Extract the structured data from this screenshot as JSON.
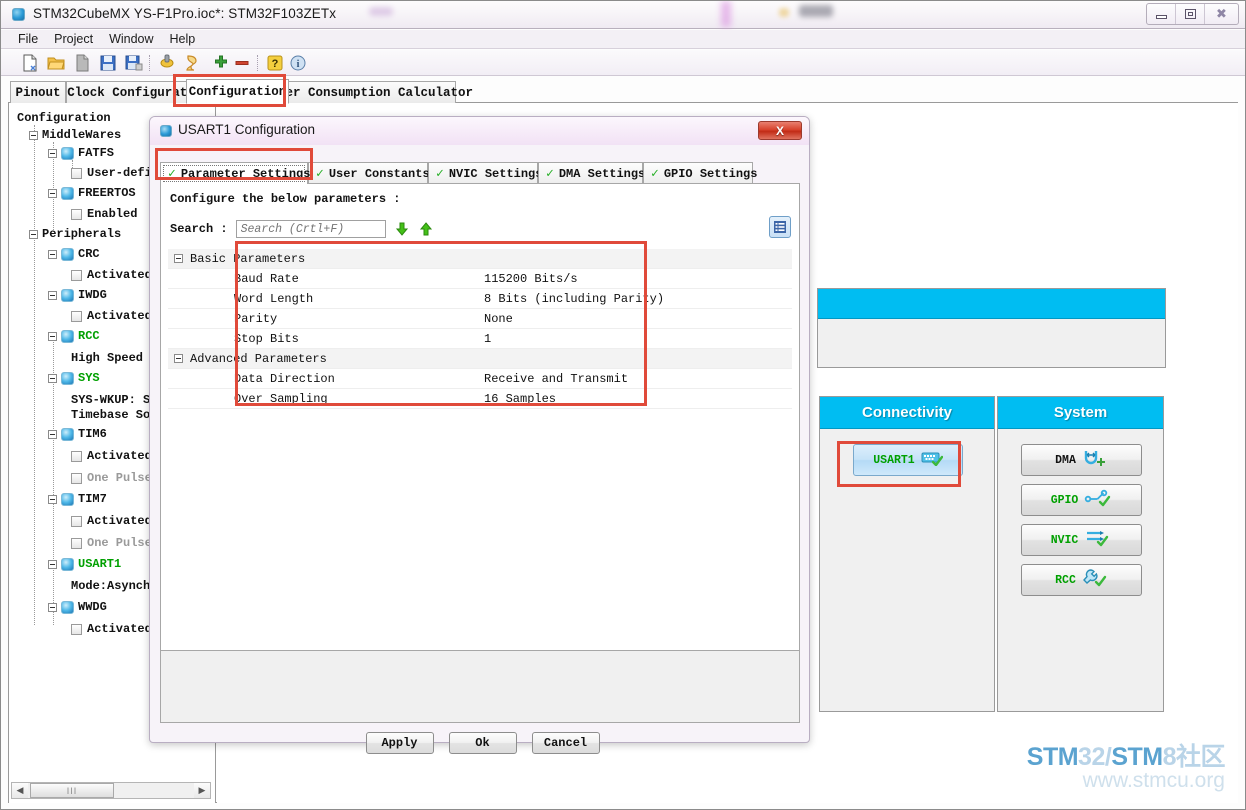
{
  "window": {
    "title": "STM32CubeMX YS-F1Pro.ioc*: STM32F103ZETx",
    "app_icon": "stm32cubemx-icon",
    "minimize": "minimize-icon",
    "maximize": "maximize-icon",
    "close": "close-icon"
  },
  "menubar": {
    "items": [
      "File",
      "Project",
      "Window",
      "Help"
    ]
  },
  "toolbar": {
    "icons": [
      "new-project-icon",
      "open-project-icon",
      "copy-icon",
      "save-icon",
      "save-as-icon",
      "generate-report-icon",
      "generate-code-icon",
      "zoom-in-icon",
      "zoom-out-icon",
      "help-icon",
      "about-icon"
    ]
  },
  "main_tabs": {
    "items": [
      {
        "label": "Pinout",
        "active": false
      },
      {
        "label": "Clock Configuration",
        "active": false
      },
      {
        "label": "Configuration",
        "active": true
      },
      {
        "label": "Power Consumption Calculator",
        "active": false
      }
    ]
  },
  "tree": {
    "root_label": "Configuration",
    "nodes": [
      {
        "label": "MiddleWares",
        "type": "group",
        "indent": 0
      },
      {
        "label": "FATFS",
        "type": "peripheral",
        "indent": 1,
        "state": "off"
      },
      {
        "label": "User-defi",
        "type": "checkbox",
        "indent": 2,
        "enabled": true
      },
      {
        "label": "FREERTOS",
        "type": "peripheral",
        "indent": 1,
        "state": "off"
      },
      {
        "label": "Enabled",
        "type": "checkbox",
        "indent": 2,
        "enabled": true
      },
      {
        "label": "Peripherals",
        "type": "group",
        "indent": 0
      },
      {
        "label": "CRC",
        "type": "peripheral",
        "indent": 1,
        "state": "off"
      },
      {
        "label": "Activated",
        "type": "checkbox",
        "indent": 2,
        "enabled": true
      },
      {
        "label": "IWDG",
        "type": "peripheral",
        "indent": 1,
        "state": "off"
      },
      {
        "label": "Activated",
        "type": "checkbox",
        "indent": 2,
        "enabled": true
      },
      {
        "label": "RCC",
        "type": "peripheral",
        "indent": 1,
        "state": "on"
      },
      {
        "label": "High Speed",
        "type": "text",
        "indent": 2
      },
      {
        "label": "SYS",
        "type": "peripheral",
        "indent": 1,
        "state": "on"
      },
      {
        "label": "SYS-WKUP: S",
        "type": "text",
        "indent": 2
      },
      {
        "label": "Timebase So",
        "type": "text",
        "indent": 2
      },
      {
        "label": "TIM6",
        "type": "peripheral",
        "indent": 1,
        "state": "off"
      },
      {
        "label": "Activated",
        "type": "checkbox",
        "indent": 2,
        "enabled": true
      },
      {
        "label": "One Pulse",
        "type": "checkbox",
        "indent": 2,
        "enabled": false
      },
      {
        "label": "TIM7",
        "type": "peripheral",
        "indent": 1,
        "state": "off"
      },
      {
        "label": "Activated",
        "type": "checkbox",
        "indent": 2,
        "enabled": true
      },
      {
        "label": "One Pulse",
        "type": "checkbox",
        "indent": 2,
        "enabled": false
      },
      {
        "label": "USART1",
        "type": "peripheral",
        "indent": 1,
        "state": "on"
      },
      {
        "label": "Mode:Asynchr",
        "type": "text",
        "indent": 2
      },
      {
        "label": "WWDG",
        "type": "peripheral",
        "indent": 1,
        "state": "off"
      },
      {
        "label": "Activated",
        "type": "checkbox",
        "indent": 2,
        "enabled": true
      }
    ],
    "scroll_left_arrow": "◀",
    "scroll_right_arrow": "▶",
    "scroll_thumb_grip": "III"
  },
  "diagram": {
    "connectivity": {
      "title": "Connectivity",
      "items": [
        {
          "label": "USART1",
          "icon": "serial-port-icon",
          "status": "configured",
          "selected": true
        }
      ]
    },
    "system": {
      "title": "System",
      "items": [
        {
          "label": "DMA",
          "icon": "dma-icon",
          "status": "add"
        },
        {
          "label": "GPIO",
          "icon": "gpio-icon",
          "status": "configured"
        },
        {
          "label": "NVIC",
          "icon": "nvic-icon",
          "status": "configured"
        },
        {
          "label": "RCC",
          "icon": "rcc-wrench-icon",
          "status": "configured"
        }
      ]
    }
  },
  "dialog": {
    "title": "USART1 Configuration",
    "icon": "dialog-app-icon",
    "close_label": "X",
    "tabs": [
      {
        "label": "Parameter Settings",
        "active": true,
        "check": true
      },
      {
        "label": "User Constants",
        "active": false,
        "check": true
      },
      {
        "label": "NVIC Settings",
        "active": false,
        "check": true
      },
      {
        "label": "DMA Settings",
        "active": false,
        "check": true
      },
      {
        "label": "GPIO Settings",
        "active": false,
        "check": true
      }
    ],
    "note": "Configure the below parameters :",
    "search": {
      "label": "Search :",
      "value": "",
      "placeholder": "Search (Crtl+F)",
      "down_icon": "arrow-down-icon",
      "up_icon": "arrow-up-icon",
      "list_icon": "list-view-icon"
    },
    "parameters": [
      {
        "kind": "group",
        "name": "Basic Parameters",
        "value": ""
      },
      {
        "kind": "row",
        "name": "Baud Rate",
        "value": "115200 Bits/s"
      },
      {
        "kind": "row",
        "name": "Word Length",
        "value": "8 Bits (including Parity)"
      },
      {
        "kind": "row",
        "name": "Parity",
        "value": "None"
      },
      {
        "kind": "row",
        "name": "Stop Bits",
        "value": "1"
      },
      {
        "kind": "group",
        "name": "Advanced Parameters",
        "value": ""
      },
      {
        "kind": "row",
        "name": "Data Direction",
        "value": "Receive and Transmit"
      },
      {
        "kind": "row",
        "name": "Over Sampling",
        "value": "16 Samples"
      }
    ],
    "buttons": [
      {
        "label": "Apply"
      },
      {
        "label": "Ok"
      },
      {
        "label": "Cancel"
      }
    ]
  },
  "annotations": {
    "color": "#e04a3a",
    "boxes": [
      "configuration-tab-highlight",
      "parameter-settings-tab-highlight",
      "parameter-table-highlight",
      "usart1-ip-button-highlight"
    ]
  },
  "watermark": {
    "line1_a": "STM",
    "line1_b": "32/",
    "line1_c": "STM",
    "line1_d": "8社区",
    "line2": "www.stmcu.org"
  }
}
